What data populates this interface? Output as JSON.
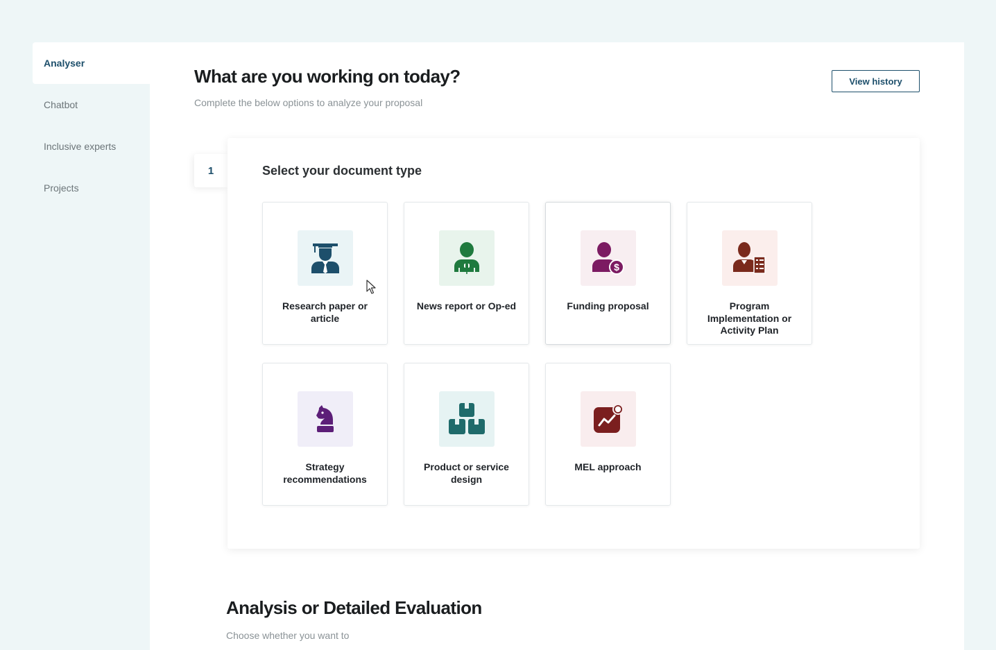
{
  "sidebar": {
    "items": [
      {
        "label": "Analyser",
        "active": true
      },
      {
        "label": "Chatbot",
        "active": false
      },
      {
        "label": "Inclusive experts",
        "active": false
      },
      {
        "label": "Projects",
        "active": false
      }
    ]
  },
  "header": {
    "title": "What are you working on today?",
    "subtitle": "Complete the below options to analyze your proposal",
    "history_button": "View history"
  },
  "step1": {
    "number": "1",
    "title": "Select your document type",
    "tiles": [
      {
        "label": "Research paper or article",
        "icon": "graduate-icon",
        "bg": "#eaf4f6",
        "color": "#1d4f6b"
      },
      {
        "label": "News report or Op-ed",
        "icon": "reporter-icon",
        "bg": "#e8f4ec",
        "color": "#1f7a3e"
      },
      {
        "label": "Funding proposal",
        "icon": "funding-icon",
        "bg": "#f8eef1",
        "color": "#7c1b62"
      },
      {
        "label": "Program Implementation or Activity Plan",
        "icon": "planner-icon",
        "bg": "#fbeeec",
        "color": "#7a2a1c"
      },
      {
        "label": "Strategy recommendations",
        "icon": "chess-knight-icon",
        "bg": "#f0eef8",
        "color": "#5c1e78"
      },
      {
        "label": "Product or service design",
        "icon": "boxes-icon",
        "bg": "#e6f3f3",
        "color": "#1f6b6b"
      },
      {
        "label": "MEL approach",
        "icon": "chart-icon",
        "bg": "#f9edee",
        "color": "#7b1f1f"
      }
    ]
  },
  "section2": {
    "title": "Analysis or Detailed Evaluation",
    "subtitle": "Choose whether you want to"
  }
}
